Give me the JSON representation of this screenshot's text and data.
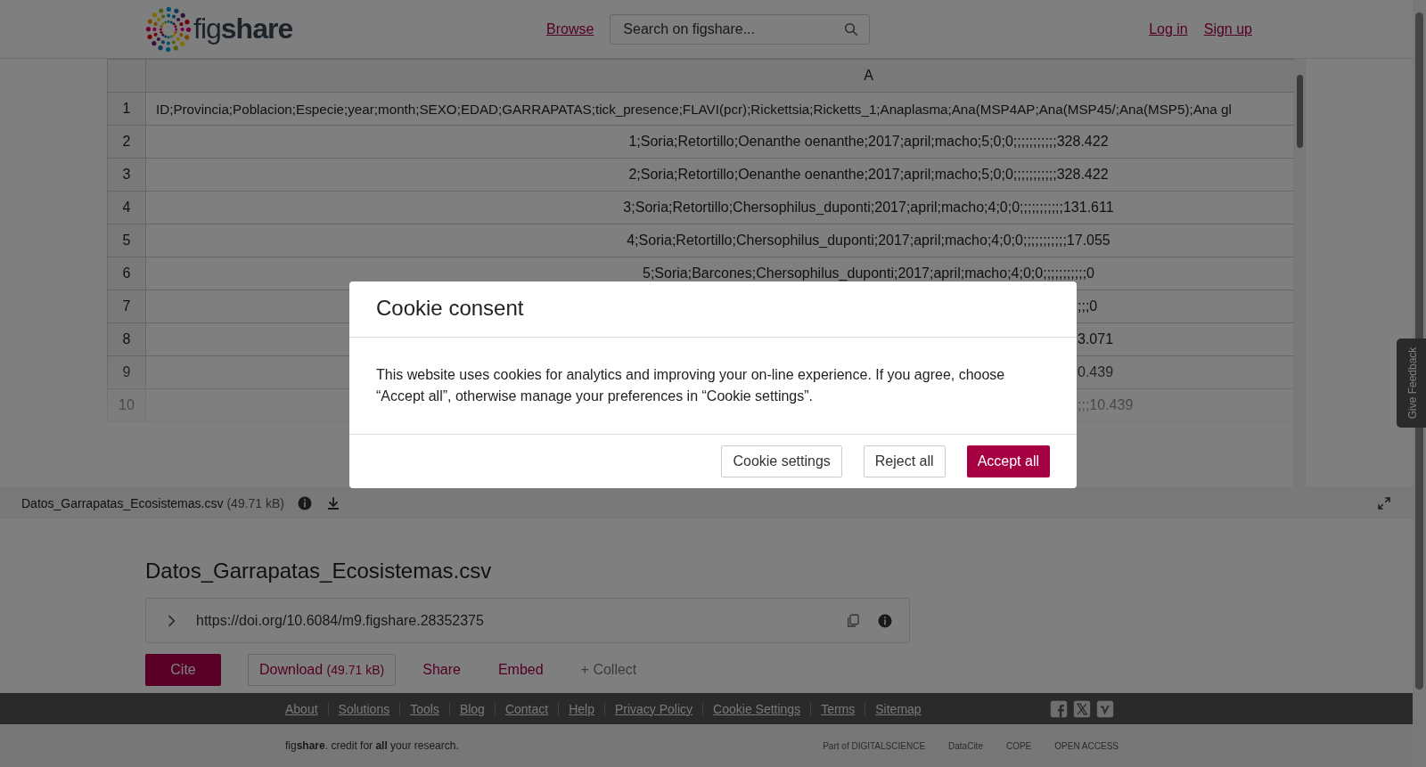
{
  "header": {
    "logo": "fig**share**",
    "nav_link": "Browse",
    "search": {
      "placeholder": "Search on figshare..."
    },
    "auth_links": [
      "Log in",
      "Sign up"
    ]
  },
  "spreadsheet": {
    "columns": [
      "A"
    ],
    "rows": [
      {
        "number": "1",
        "cell": "ID;Provincia;Poblacion;Especie;year;month;SEXO;EDAD;GARRAPATAS;tick_presence;FLAVI(pcr);Rickettsia;Ricketts_1;Anaplasma;Ana(MSP4AP;Ana(MSP45/;Ana(MSP5);Ana gl",
        "kind": "left"
      },
      {
        "number": "2",
        "cell": "1;Soria;Retortillo;Oenanthe oenanthe;2017;april;macho;5;0;0;;;;;;;;;;;328.422",
        "kind": "center"
      },
      {
        "number": "3",
        "cell": "2;Soria;Retortillo;Oenanthe oenanthe;2017;april;macho;5;0;0;;;;;;;;;;;328.422",
        "kind": "center"
      },
      {
        "number": "4",
        "cell": "3;Soria;Retortillo;Chersophilus_duponti;2017;april;macho;4;0;0;;;;;;;;;;;131.611",
        "kind": "center"
      },
      {
        "number": "5",
        "cell": "4;Soria;Retortillo;Chersophilus_duponti;2017;april;macho;4;0;0;;;;;;;;;;;17.055",
        "kind": "center"
      },
      {
        "number": "6",
        "cell": "5;Soria;Barcones;Chersophilus_duponti;2017;april;macho;4;0;0;;;;;;;;;;;0",
        "kind": "center"
      },
      {
        "number": "7",
        "cell": ";;;0",
        "kind": "covered"
      },
      {
        "number": "8",
        "cell": "3.071",
        "kind": "covered"
      },
      {
        "number": "9",
        "cell": "0.439",
        "kind": "covered"
      },
      {
        "number": "10",
        "cell": ";;;10.439",
        "kind": "covered"
      }
    ]
  },
  "file_bar": {
    "file_name": "Datos_Garrapatas_Ecosistemas.csv",
    "size": "(49.71 kB)"
  },
  "article": {
    "title": "Datos_Garrapatas_Ecosistemas.csv",
    "doi": "https://doi.org/10.6084/m9.figshare.28352375",
    "actions": [
      {
        "label": "Cite",
        "kind": "primary"
      },
      {
        "label": "Download",
        "size": "(49.71 kB)",
        "kind": "outline"
      },
      {
        "label": "Share",
        "kind": "link"
      },
      {
        "label": "Embed",
        "kind": "link"
      },
      {
        "label": "+ Collect",
        "kind": "muted"
      }
    ]
  },
  "footer": {
    "links": [
      "About",
      "Solutions",
      "Tools",
      "Blog",
      "Contact",
      "Help",
      "Privacy Policy",
      "Cookie Settings",
      "Terms",
      "Sitemap"
    ],
    "tagline": "fig**share**. credit for **all** your research.",
    "partners": [
      "Part of DIGITALSCIENCE",
      "DataCite",
      "COPE",
      "OPEN ACCESS"
    ]
  },
  "cookie_modal": {
    "title": "Cookie consent",
    "body": "This website uses cookies for analytics and improving your on-line experience. If you agree, choose “Accept all”, otherwise manage your preferences in “Cookie settings”.",
    "buttons": [
      {
        "label": "Cookie settings",
        "kind": "secondary"
      },
      {
        "label": "Reject all",
        "kind": "secondary"
      },
      {
        "label": "Accept all",
        "kind": "primary"
      }
    ]
  },
  "feedback_tab": "Give Feedback"
}
